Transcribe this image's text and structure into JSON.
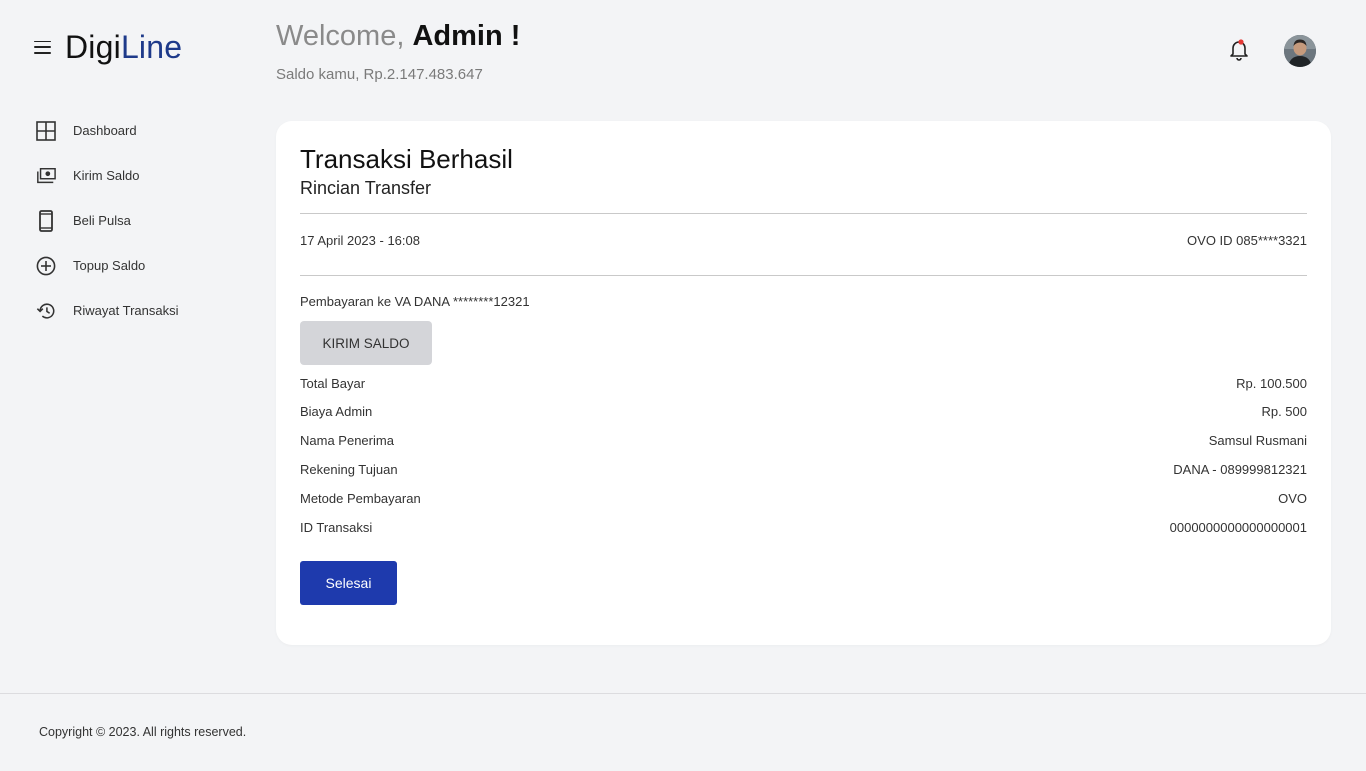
{
  "brand": {
    "prefix": "Digi",
    "accent": "Line",
    "accent_color": "#1e3a8a"
  },
  "sidebar": {
    "items": [
      {
        "label": "Dashboard",
        "icon": "grid-icon"
      },
      {
        "label": "Kirim Saldo",
        "icon": "money-icon"
      },
      {
        "label": "Beli Pulsa",
        "icon": "phone-icon"
      },
      {
        "label": "Topup Saldo",
        "icon": "plus-circle-icon"
      },
      {
        "label": "Riwayat Transaksi",
        "icon": "history-icon"
      }
    ]
  },
  "header": {
    "welcome_prefix": "Welcome,",
    "user_name": "Admin !",
    "balance_text": "Saldo kamu, Rp.2.147.483.647",
    "notification_icon": "bell-icon",
    "notification_dot_color": "#e53935"
  },
  "card": {
    "title": "Transaksi Berhasil",
    "subtitle": "Rincian Transfer",
    "datetime": "17 April 2023 - 16:08",
    "source_account": "OVO ID 085****3321",
    "payment_to": "Pembayaran ke VA DANA ********12321",
    "type_button": "KIRIM SALDO",
    "details": [
      {
        "label": "Total Bayar",
        "value": "Rp. 100.500"
      },
      {
        "label": "Biaya Admin",
        "value": "Rp. 500"
      },
      {
        "label": "Nama Penerima",
        "value": "Samsul Rusmani"
      },
      {
        "label": "Rekening Tujuan",
        "value": "DANA - 089999812321"
      },
      {
        "label": "Metode Pembayaran",
        "value": "OVO"
      },
      {
        "label": "ID Transaksi",
        "value": "0000000000000000001"
      }
    ],
    "done_button": "Selesai",
    "done_button_color": "#1e3aad"
  },
  "footer": {
    "copyright": "Copyright © 2023. All rights reserved."
  }
}
